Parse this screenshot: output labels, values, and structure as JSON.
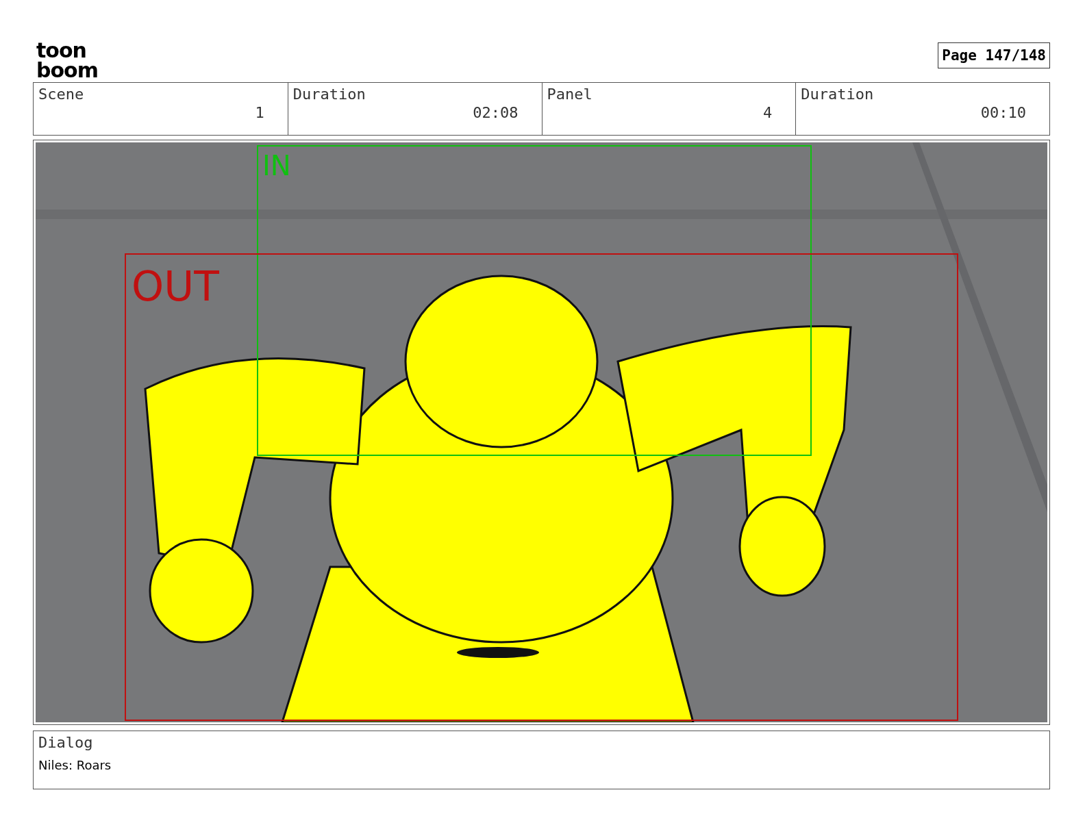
{
  "logo": [
    "toon",
    "boom"
  ],
  "page": "Page 147/148",
  "info": [
    {
      "label": "Scene",
      "value": "1"
    },
    {
      "label": "Duration",
      "value": "02:08"
    },
    {
      "label": "Panel",
      "value": "4"
    },
    {
      "label": "Duration",
      "value": "00:10"
    }
  ],
  "panel": {
    "frames": [
      {
        "label": "IN",
        "color": "#10c010"
      },
      {
        "label": "OUT",
        "color": "#c01010"
      }
    ]
  },
  "dialog": {
    "label": "Dialog",
    "text": "Niles: Roars"
  }
}
